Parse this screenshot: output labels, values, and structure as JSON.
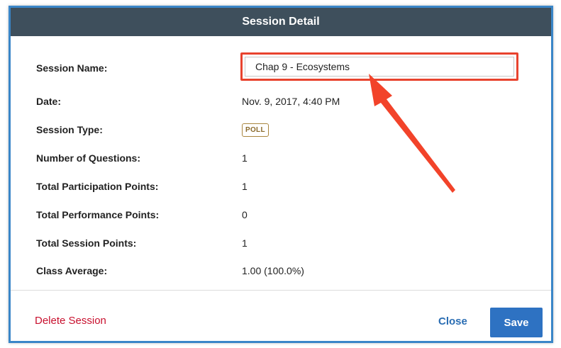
{
  "dialog": {
    "title": "Session Detail",
    "fields": {
      "session_name_label": "Session Name:",
      "session_name_value": "Chap 9 - Ecosystems",
      "date_label": "Date:",
      "date_value": "Nov. 9, 2017, 4:40 PM",
      "session_type_label": "Session Type:",
      "session_type_value": "POLL",
      "num_questions_label": "Number of Questions:",
      "num_questions_value": "1",
      "participation_label": "Total Participation Points:",
      "participation_value": "1",
      "performance_label": "Total Performance Points:",
      "performance_value": "0",
      "session_points_label": "Total Session Points:",
      "session_points_value": "1",
      "class_average_label": "Class Average:",
      "class_average_value": "1.00 (100.0%)"
    },
    "footer": {
      "delete_label": "Delete Session",
      "close_label": "Close",
      "save_label": "Save"
    }
  },
  "annotation": {
    "highlight_color": "#e8432e",
    "arrow_icon": "red-arrow-icon"
  },
  "colors": {
    "header_bg": "#3e4f5c",
    "primary": "#2e72c2",
    "danger": "#c8102e",
    "frame_border": "#3a86c8"
  }
}
